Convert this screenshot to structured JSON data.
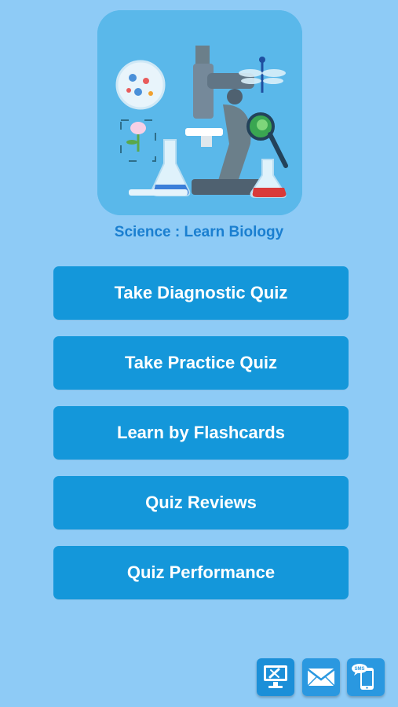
{
  "app": {
    "title": "Science : Learn Biology",
    "icon_name": "microscope-lab-icon"
  },
  "menu": {
    "items": [
      {
        "label": "Take Diagnostic Quiz"
      },
      {
        "label": "Take Practice Quiz"
      },
      {
        "label": "Learn by Flashcards"
      },
      {
        "label": "Quiz Reviews"
      },
      {
        "label": "Quiz Performance"
      }
    ]
  },
  "bottom_bar": {
    "icons": [
      "desktop-tools-icon",
      "mail-icon",
      "sms-icon"
    ],
    "sms_text": "SMS"
  },
  "colors": {
    "background": "#8ecbf6",
    "button": "#1497da",
    "title": "#1a7fd0"
  }
}
